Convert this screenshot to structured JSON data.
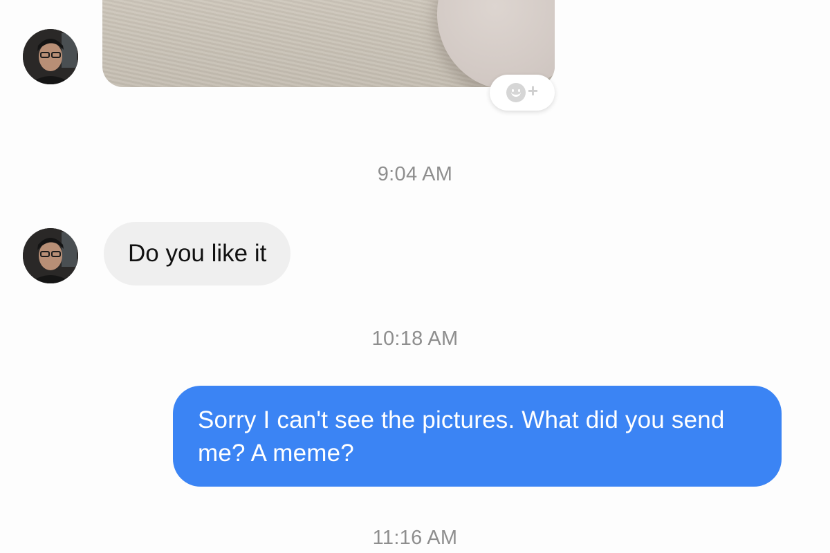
{
  "conversation": {
    "messages": [
      {
        "type": "image",
        "sender": "them"
      },
      {
        "type": "timestamp",
        "text": "9:04 AM"
      },
      {
        "type": "text",
        "sender": "them",
        "text": "Do you like it"
      },
      {
        "type": "timestamp",
        "text": "10:18 AM"
      },
      {
        "type": "text",
        "sender": "me",
        "text": "Sorry I can't see the pictures. What did you send me? A meme?"
      },
      {
        "type": "timestamp",
        "text": "11:16 AM"
      }
    ]
  },
  "reaction_button": {
    "icon": "smiley-add-icon",
    "symbol": "+"
  },
  "colors": {
    "outgoing_bubble": "#3b84f4",
    "incoming_bubble": "#efefef",
    "timestamp_text": "#8e8e8e"
  }
}
